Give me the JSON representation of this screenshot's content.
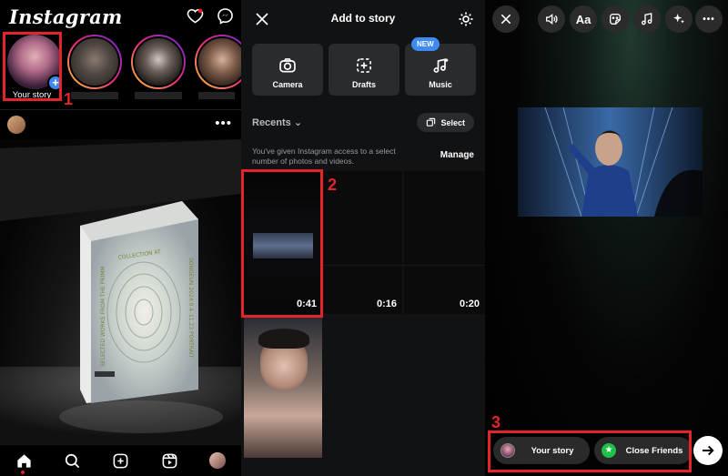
{
  "feed": {
    "app_title": "Instagram",
    "your_story_label": "Your story",
    "step_label": "1"
  },
  "add_to_story": {
    "title": "Add to story",
    "tiles": [
      {
        "label": "Camera"
      },
      {
        "label": "Drafts"
      },
      {
        "label": "Music",
        "badge": "NEW"
      }
    ],
    "recents_label": "Recents",
    "select_label": "Select",
    "access_note": "You've given Instagram access to a select number of photos and videos.",
    "manage_label": "Manage",
    "durations": [
      "0:41",
      "0:16",
      "0:20"
    ],
    "step_label": "2"
  },
  "story_editor": {
    "text_tool_label": "Aa",
    "your_story_label": "Your story",
    "close_friends_label": "Close Friends",
    "step_label": "3"
  },
  "colors": {
    "highlight": "#e3242b",
    "accent_blue": "#3d8bf2",
    "close_friends_green": "#1ec04a"
  }
}
